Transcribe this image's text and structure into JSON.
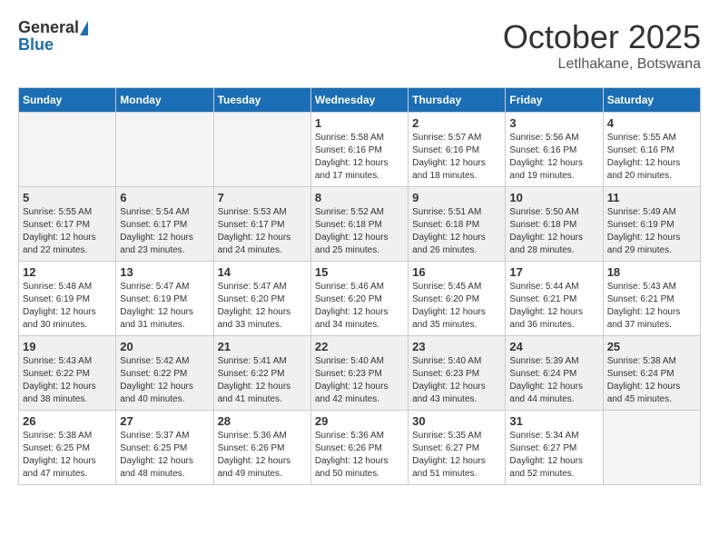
{
  "header": {
    "logo_general": "General",
    "logo_blue": "Blue",
    "month": "October 2025",
    "location": "Letlhakane, Botswana"
  },
  "days_of_week": [
    "Sunday",
    "Monday",
    "Tuesday",
    "Wednesday",
    "Thursday",
    "Friday",
    "Saturday"
  ],
  "weeks": [
    {
      "shaded": false,
      "days": [
        {
          "date": "",
          "sunrise": "",
          "sunset": "",
          "daylight": ""
        },
        {
          "date": "",
          "sunrise": "",
          "sunset": "",
          "daylight": ""
        },
        {
          "date": "",
          "sunrise": "",
          "sunset": "",
          "daylight": ""
        },
        {
          "date": "1",
          "sunrise": "Sunrise: 5:58 AM",
          "sunset": "Sunset: 6:16 PM",
          "daylight": "Daylight: 12 hours and 17 minutes."
        },
        {
          "date": "2",
          "sunrise": "Sunrise: 5:57 AM",
          "sunset": "Sunset: 6:16 PM",
          "daylight": "Daylight: 12 hours and 18 minutes."
        },
        {
          "date": "3",
          "sunrise": "Sunrise: 5:56 AM",
          "sunset": "Sunset: 6:16 PM",
          "daylight": "Daylight: 12 hours and 19 minutes."
        },
        {
          "date": "4",
          "sunrise": "Sunrise: 5:55 AM",
          "sunset": "Sunset: 6:16 PM",
          "daylight": "Daylight: 12 hours and 20 minutes."
        }
      ]
    },
    {
      "shaded": true,
      "days": [
        {
          "date": "5",
          "sunrise": "Sunrise: 5:55 AM",
          "sunset": "Sunset: 6:17 PM",
          "daylight": "Daylight: 12 hours and 22 minutes."
        },
        {
          "date": "6",
          "sunrise": "Sunrise: 5:54 AM",
          "sunset": "Sunset: 6:17 PM",
          "daylight": "Daylight: 12 hours and 23 minutes."
        },
        {
          "date": "7",
          "sunrise": "Sunrise: 5:53 AM",
          "sunset": "Sunset: 6:17 PM",
          "daylight": "Daylight: 12 hours and 24 minutes."
        },
        {
          "date": "8",
          "sunrise": "Sunrise: 5:52 AM",
          "sunset": "Sunset: 6:18 PM",
          "daylight": "Daylight: 12 hours and 25 minutes."
        },
        {
          "date": "9",
          "sunrise": "Sunrise: 5:51 AM",
          "sunset": "Sunset: 6:18 PM",
          "daylight": "Daylight: 12 hours and 26 minutes."
        },
        {
          "date": "10",
          "sunrise": "Sunrise: 5:50 AM",
          "sunset": "Sunset: 6:18 PM",
          "daylight": "Daylight: 12 hours and 28 minutes."
        },
        {
          "date": "11",
          "sunrise": "Sunrise: 5:49 AM",
          "sunset": "Sunset: 6:19 PM",
          "daylight": "Daylight: 12 hours and 29 minutes."
        }
      ]
    },
    {
      "shaded": false,
      "days": [
        {
          "date": "12",
          "sunrise": "Sunrise: 5:48 AM",
          "sunset": "Sunset: 6:19 PM",
          "daylight": "Daylight: 12 hours and 30 minutes."
        },
        {
          "date": "13",
          "sunrise": "Sunrise: 5:47 AM",
          "sunset": "Sunset: 6:19 PM",
          "daylight": "Daylight: 12 hours and 31 minutes."
        },
        {
          "date": "14",
          "sunrise": "Sunrise: 5:47 AM",
          "sunset": "Sunset: 6:20 PM",
          "daylight": "Daylight: 12 hours and 33 minutes."
        },
        {
          "date": "15",
          "sunrise": "Sunrise: 5:46 AM",
          "sunset": "Sunset: 6:20 PM",
          "daylight": "Daylight: 12 hours and 34 minutes."
        },
        {
          "date": "16",
          "sunrise": "Sunrise: 5:45 AM",
          "sunset": "Sunset: 6:20 PM",
          "daylight": "Daylight: 12 hours and 35 minutes."
        },
        {
          "date": "17",
          "sunrise": "Sunrise: 5:44 AM",
          "sunset": "Sunset: 6:21 PM",
          "daylight": "Daylight: 12 hours and 36 minutes."
        },
        {
          "date": "18",
          "sunrise": "Sunrise: 5:43 AM",
          "sunset": "Sunset: 6:21 PM",
          "daylight": "Daylight: 12 hours and 37 minutes."
        }
      ]
    },
    {
      "shaded": true,
      "days": [
        {
          "date": "19",
          "sunrise": "Sunrise: 5:43 AM",
          "sunset": "Sunset: 6:22 PM",
          "daylight": "Daylight: 12 hours and 38 minutes."
        },
        {
          "date": "20",
          "sunrise": "Sunrise: 5:42 AM",
          "sunset": "Sunset: 6:22 PM",
          "daylight": "Daylight: 12 hours and 40 minutes."
        },
        {
          "date": "21",
          "sunrise": "Sunrise: 5:41 AM",
          "sunset": "Sunset: 6:22 PM",
          "daylight": "Daylight: 12 hours and 41 minutes."
        },
        {
          "date": "22",
          "sunrise": "Sunrise: 5:40 AM",
          "sunset": "Sunset: 6:23 PM",
          "daylight": "Daylight: 12 hours and 42 minutes."
        },
        {
          "date": "23",
          "sunrise": "Sunrise: 5:40 AM",
          "sunset": "Sunset: 6:23 PM",
          "daylight": "Daylight: 12 hours and 43 minutes."
        },
        {
          "date": "24",
          "sunrise": "Sunrise: 5:39 AM",
          "sunset": "Sunset: 6:24 PM",
          "daylight": "Daylight: 12 hours and 44 minutes."
        },
        {
          "date": "25",
          "sunrise": "Sunrise: 5:38 AM",
          "sunset": "Sunset: 6:24 PM",
          "daylight": "Daylight: 12 hours and 45 minutes."
        }
      ]
    },
    {
      "shaded": false,
      "days": [
        {
          "date": "26",
          "sunrise": "Sunrise: 5:38 AM",
          "sunset": "Sunset: 6:25 PM",
          "daylight": "Daylight: 12 hours and 47 minutes."
        },
        {
          "date": "27",
          "sunrise": "Sunrise: 5:37 AM",
          "sunset": "Sunset: 6:25 PM",
          "daylight": "Daylight: 12 hours and 48 minutes."
        },
        {
          "date": "28",
          "sunrise": "Sunrise: 5:36 AM",
          "sunset": "Sunset: 6:26 PM",
          "daylight": "Daylight: 12 hours and 49 minutes."
        },
        {
          "date": "29",
          "sunrise": "Sunrise: 5:36 AM",
          "sunset": "Sunset: 6:26 PM",
          "daylight": "Daylight: 12 hours and 50 minutes."
        },
        {
          "date": "30",
          "sunrise": "Sunrise: 5:35 AM",
          "sunset": "Sunset: 6:27 PM",
          "daylight": "Daylight: 12 hours and 51 minutes."
        },
        {
          "date": "31",
          "sunrise": "Sunrise: 5:34 AM",
          "sunset": "Sunset: 6:27 PM",
          "daylight": "Daylight: 12 hours and 52 minutes."
        },
        {
          "date": "",
          "sunrise": "",
          "sunset": "",
          "daylight": ""
        }
      ]
    }
  ]
}
